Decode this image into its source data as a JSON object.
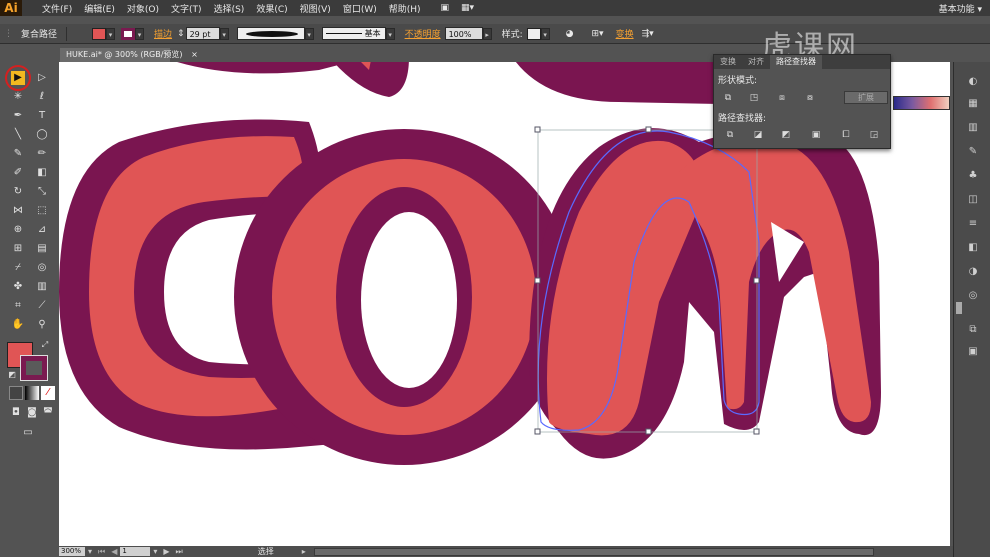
{
  "menubar": {
    "logo": "Ai",
    "items": [
      "文件(F)",
      "编辑(E)",
      "对象(O)",
      "文字(T)",
      "选择(S)",
      "效果(C)",
      "视图(V)",
      "窗口(W)",
      "帮助(H)"
    ],
    "workspace": "基本功能",
    "workspace_arrow": "▾"
  },
  "controlbar": {
    "object_type": "复合路径",
    "stroke_label": "描边",
    "stroke_weight": "29 pt",
    "brush_label": "基本",
    "opacity_label": "不透明度",
    "opacity_value": "100%",
    "style_label": "样式:",
    "transform_label": "变换",
    "fill_color": "#e05555",
    "stroke_color": "#7a1a50"
  },
  "document": {
    "tab_title": "HUKE.ai* @ 300% (RGB/预览)",
    "close": "×"
  },
  "pathfinder": {
    "tabs": [
      "变换",
      "对齐",
      "路径查找器"
    ],
    "shape_modes_label": "形状模式:",
    "expand_label": "扩展",
    "pathfinders_label": "路径查找器:"
  },
  "statusbar": {
    "zoom": "300%",
    "page": "1",
    "tool": "选择"
  },
  "watermark": "虎课网",
  "colors": {
    "letter_fill": "#e05555",
    "letter_outline": "#7a1550",
    "selection": "#5a6aff"
  }
}
